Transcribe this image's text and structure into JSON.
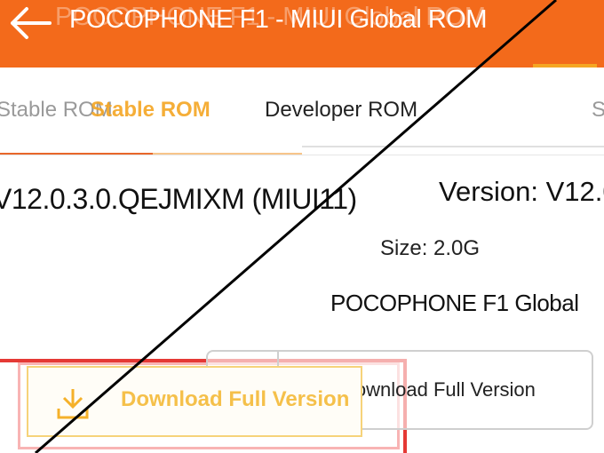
{
  "appbar": {
    "title": "POCOPHONE F1 - MIUI Global ROM",
    "ghost_title": "POCOPHONE F1 - MIUI Global ROM"
  },
  "tabs": {
    "stable_ghost": "Stable ROM",
    "stable": "Stable ROM",
    "developer": "Developer ROM",
    "third": "S"
  },
  "rom": {
    "ghost_version": "V12.0.3.0.QEJMIXM (MIUI11)",
    "version": "Version: V12.0",
    "size": "Size: 2.0G",
    "device": "POCOPHONE F1 Global"
  },
  "download": {
    "primary_label": "Download Full Version",
    "secondary_label": "Download Full Version"
  },
  "colors": {
    "brand": "#f36a1b",
    "accent": "#f5a623",
    "highlight_red": "#e53935"
  },
  "icons": {
    "back": "arrow-left-icon",
    "download": "download-icon"
  }
}
